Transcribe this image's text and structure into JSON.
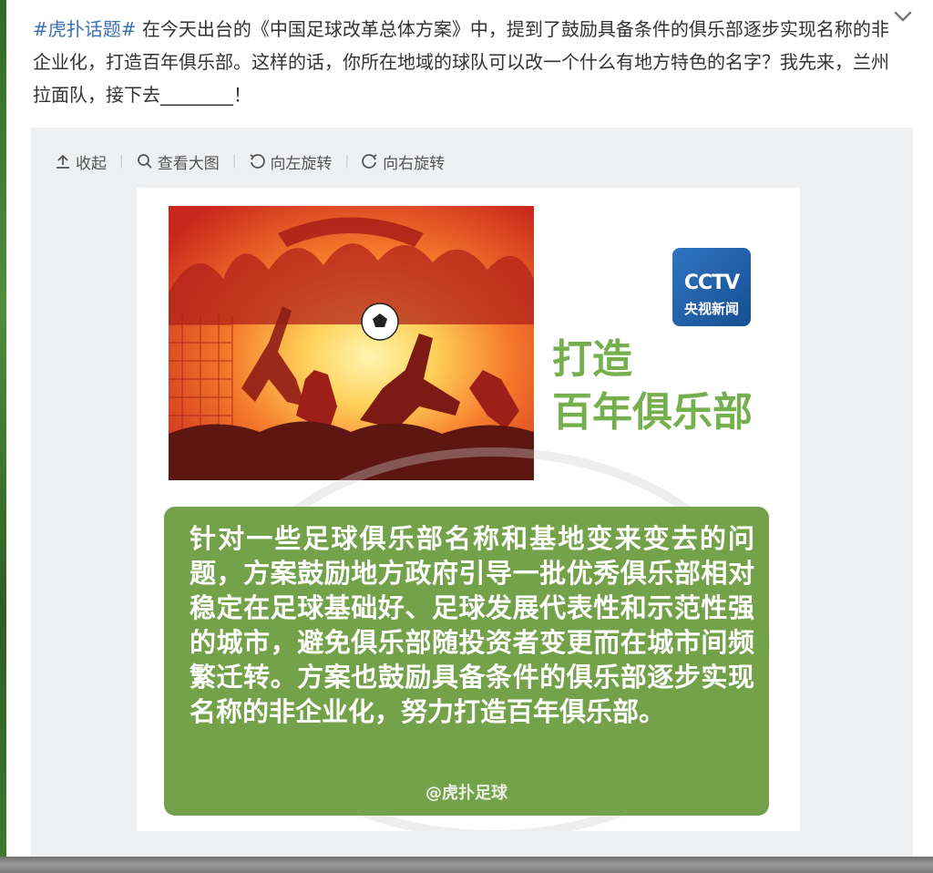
{
  "post": {
    "topic": "#虎扑话题#",
    "body": " 在今天出台的《中国足球改革总体方案》中，提到了鼓励具备条件的俱乐部逐步实现名称的非企业化，打造百年俱乐部。这样的话，你所在地域的球队可以改一个什么有地方特色的名字？我先来，兰州拉面队，接下去________！"
  },
  "toolbar": {
    "collapse": "收起",
    "view_large": "查看大图",
    "rotate_left": "向左旋转",
    "rotate_right": "向右旋转"
  },
  "image": {
    "logo_mark": "CCTV",
    "logo_sub": "央视新闻",
    "headline_line1": "打造",
    "headline_line2": "百年俱乐部",
    "box_text": "针对一些足球俱乐部名称和基地变来变去的问题，方案鼓励地方政府引导一批优秀俱乐部相对稳定在足球基础好、足球发展代表性和示范性强的城市，避免俱乐部随投资者变更而在城市间频繁迁转。方案也鼓励具备条件的俱乐部逐步实现名称的非企业化，努力打造百年俱乐部。",
    "credit": "@虎扑足球"
  },
  "icons": {
    "chevron": "chevron-down-icon",
    "collapse": "upload-arrow-icon",
    "view_large": "magnifier-icon",
    "rotate_left": "rotate-left-icon",
    "rotate_right": "rotate-right-icon"
  },
  "colors": {
    "topic_link": "#3b6fb6",
    "headline_green": "#76b04e",
    "box_green": "#74a24a",
    "cctv_blue": "#2f74c0"
  }
}
